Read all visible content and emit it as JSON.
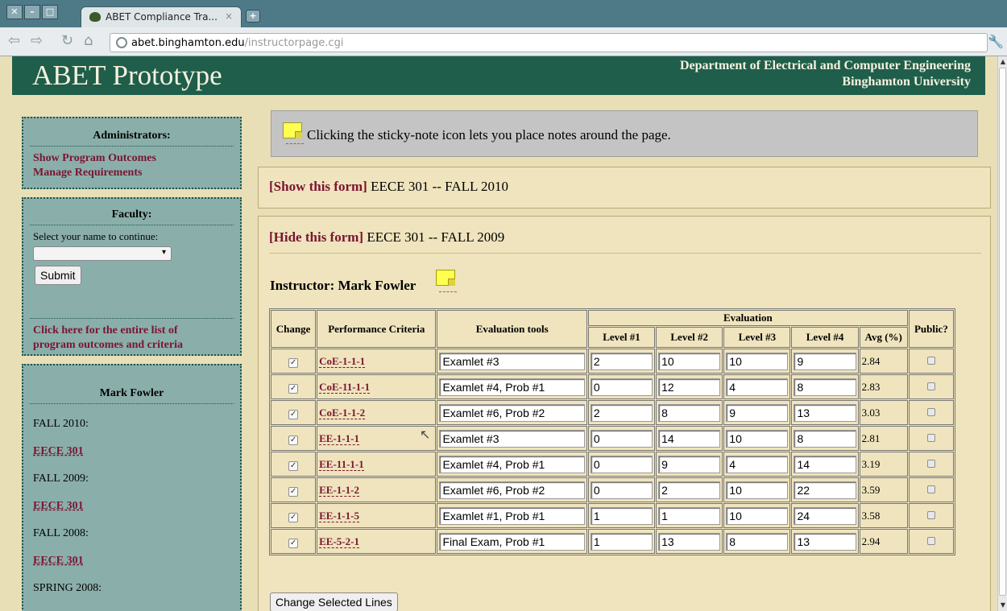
{
  "browser": {
    "tab_title": "ABET Compliance Tra...",
    "tab_close": "×",
    "new_tab": "+",
    "url_host": "abet.binghamton.edu",
    "url_path": "/instructorpage.cgi",
    "win_buttons": [
      "✕",
      "–",
      "□"
    ],
    "nav_icons": [
      "back-icon",
      "forward-icon",
      "reload-icon",
      "home-icon"
    ]
  },
  "header": {
    "title": "ABET Prototype",
    "dept_line1": "Department of Electrical and Computer Engineering",
    "dept_line2": "Binghamton University",
    "bg_color": "#1f5e4a"
  },
  "sidebar": {
    "admin": {
      "title": "Administrators:",
      "links": [
        "Show Program Outcomes",
        "Manage Requirements"
      ]
    },
    "faculty": {
      "title": "Faculty:",
      "prompt": "Select your name to continue:",
      "select_value": "",
      "submit_label": "Submit",
      "outcomes_link": "Click here for the entire list of program outcomes and criteria"
    },
    "instructor_box": {
      "title": "Mark Fowler",
      "terms": [
        {
          "term": "FALL 2010:",
          "course": "EECE 301"
        },
        {
          "term": "FALL 2009:",
          "course": "EECE 301"
        },
        {
          "term": "FALL 2008:",
          "course": "EECE 301"
        },
        {
          "term": "SPRING 2008:",
          "course": ""
        }
      ]
    }
  },
  "tip": {
    "text": "Clicking the sticky-note icon lets you place notes around the page."
  },
  "forms": [
    {
      "link": "[Show this form]",
      "title": "EECE 301 -- FALL 2010"
    },
    {
      "link": "[Hide this form]",
      "title": "EECE 301 -- FALL 2009"
    }
  ],
  "instructor_label": "Instructor: Mark Fowler",
  "table": {
    "headers": {
      "change": "Change",
      "criteria": "Performance Criteria",
      "tools": "Evaluation tools",
      "evaluation": "Evaluation",
      "levels": [
        "Level #1",
        "Level #2",
        "Level #3",
        "Level #4",
        "Avg (%)"
      ],
      "public": "Public?"
    },
    "rows": [
      {
        "criteria": "CoE-1-1-1",
        "tool": "Examlet #3",
        "l1": "2",
        "l2": "10",
        "l3": "10",
        "l4": "9",
        "avg": "2.84"
      },
      {
        "criteria": "CoE-11-1-1",
        "tool": "Examlet #4, Prob #1",
        "l1": "0",
        "l2": "12",
        "l3": "4",
        "l4": "8",
        "avg": "2.83"
      },
      {
        "criteria": "CoE-1-1-2",
        "tool": "Examlet #6, Prob #2",
        "l1": "2",
        "l2": "8",
        "l3": "9",
        "l4": "13",
        "avg": "3.03"
      },
      {
        "criteria": "EE-1-1-1",
        "tool": "Examlet #3",
        "l1": "0",
        "l2": "14",
        "l3": "10",
        "l4": "8",
        "avg": "2.81"
      },
      {
        "criteria": "EE-11-1-1",
        "tool": "Examlet #4, Prob #1",
        "l1": "0",
        "l2": "9",
        "l3": "4",
        "l4": "14",
        "avg": "3.19"
      },
      {
        "criteria": "EE-1-1-2",
        "tool": "Examlet #6, Prob #2",
        "l1": "0",
        "l2": "2",
        "l3": "10",
        "l4": "22",
        "avg": "3.59"
      },
      {
        "criteria": "EE-1-1-5",
        "tool": "Examlet #1, Prob #1",
        "l1": "1",
        "l2": "1",
        "l3": "10",
        "l4": "24",
        "avg": "3.58"
      },
      {
        "criteria": "EE-5-2-1",
        "tool": "Final Exam, Prob #1",
        "l1": "1",
        "l2": "13",
        "l3": "8",
        "l4": "13",
        "avg": "2.94"
      }
    ]
  },
  "change_button": "Change Selected Lines"
}
